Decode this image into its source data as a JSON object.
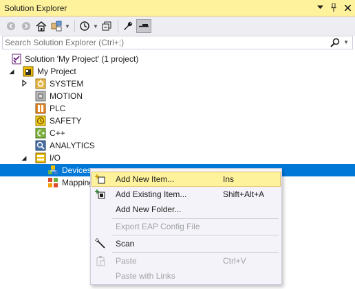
{
  "window": {
    "title": "Solution Explorer",
    "title_icons": [
      "dropdown-arrow-icon",
      "pin-icon",
      "close-icon"
    ]
  },
  "toolbar": {
    "buttons": [
      "back-icon",
      "forward-icon",
      "home-icon",
      "switch-views-icon",
      "pending-changes-filter-icon",
      "collapse-all-icon",
      "properties-icon",
      "preview-selected-items-icon"
    ]
  },
  "search": {
    "placeholder": "Search Solution Explorer (Ctrl+;)"
  },
  "tree": {
    "solution": "Solution 'My Project' (1 project)",
    "project": "My Project",
    "items": {
      "system": "SYSTEM",
      "motion": "MOTION",
      "plc": "PLC",
      "safety": "SAFETY",
      "cpp": "C++",
      "analytics": "ANALYTICS",
      "io": "I/O",
      "devices": "Devices",
      "mappings": "Mappings"
    }
  },
  "context_menu": {
    "add_new_item": {
      "label": "Add New Item...",
      "shortcut": "Ins"
    },
    "add_existing_item": {
      "label": "Add Existing Item...",
      "shortcut": "Shift+Alt+A"
    },
    "add_new_folder": {
      "label": "Add New Folder..."
    },
    "export_eap": {
      "label": "Export EAP Config File"
    },
    "scan": {
      "label": "Scan"
    },
    "paste": {
      "label": "Paste",
      "shortcut": "Ctrl+V"
    },
    "paste_links": {
      "label": "Paste with Links"
    }
  },
  "colors": {
    "title_bar": "#fff29d",
    "selection": "#0078d7",
    "menu_hover": "#fff29d",
    "menu_background": "#f3f3f9"
  }
}
